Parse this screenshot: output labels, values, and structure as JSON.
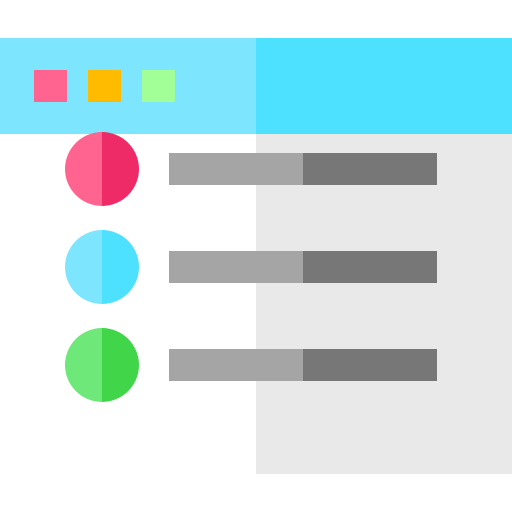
{
  "colors": {
    "titlebar_left": "#7ee5fe",
    "titlebar_right": "#4de0ff",
    "body_left": "#ffffff",
    "body_right": "#e9e9e9",
    "bar_light": "#a5a5a5",
    "bar_dark": "#777777"
  },
  "window_buttons": [
    {
      "icon": "square-icon",
      "color": "#ff6490"
    },
    {
      "icon": "square-icon",
      "color": "#ffbb00"
    },
    {
      "icon": "square-icon",
      "color": "#a2ff98"
    }
  ],
  "list_items": [
    {
      "bullet_icon": "circle-icon",
      "color_left": "#ff6490",
      "color_right": "#ee2a67"
    },
    {
      "bullet_icon": "circle-icon",
      "color_left": "#7ee5fe",
      "color_right": "#4de0ff"
    },
    {
      "bullet_icon": "circle-icon",
      "color_left": "#6ee878",
      "color_right": "#41d64a"
    }
  ]
}
